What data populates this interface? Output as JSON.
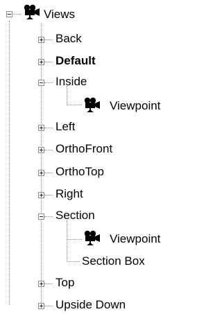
{
  "tree": {
    "root": {
      "label": "Views",
      "icon": "camera-icon",
      "expanded": true,
      "children": [
        {
          "label": "Back",
          "expanded": false
        },
        {
          "label": "Default",
          "expanded": false,
          "bold": true
        },
        {
          "label": "Inside",
          "expanded": true,
          "children": [
            {
              "label": "Viewpoint",
              "icon": "camera-icon"
            }
          ]
        },
        {
          "label": "Left",
          "expanded": false
        },
        {
          "label": "OrthoFront",
          "expanded": false
        },
        {
          "label": "OrthoTop",
          "expanded": false
        },
        {
          "label": "Right",
          "expanded": false
        },
        {
          "label": "Section",
          "expanded": true,
          "children": [
            {
              "label": "Viewpoint",
              "icon": "camera-icon"
            },
            {
              "label": "Section Box"
            }
          ]
        },
        {
          "label": "Top",
          "expanded": false
        },
        {
          "label": "Upside Down",
          "expanded": false
        }
      ]
    }
  },
  "colors": {
    "connector": "#8a8a8a",
    "toggle_border": "#8c8c8c",
    "text": "#000000"
  }
}
